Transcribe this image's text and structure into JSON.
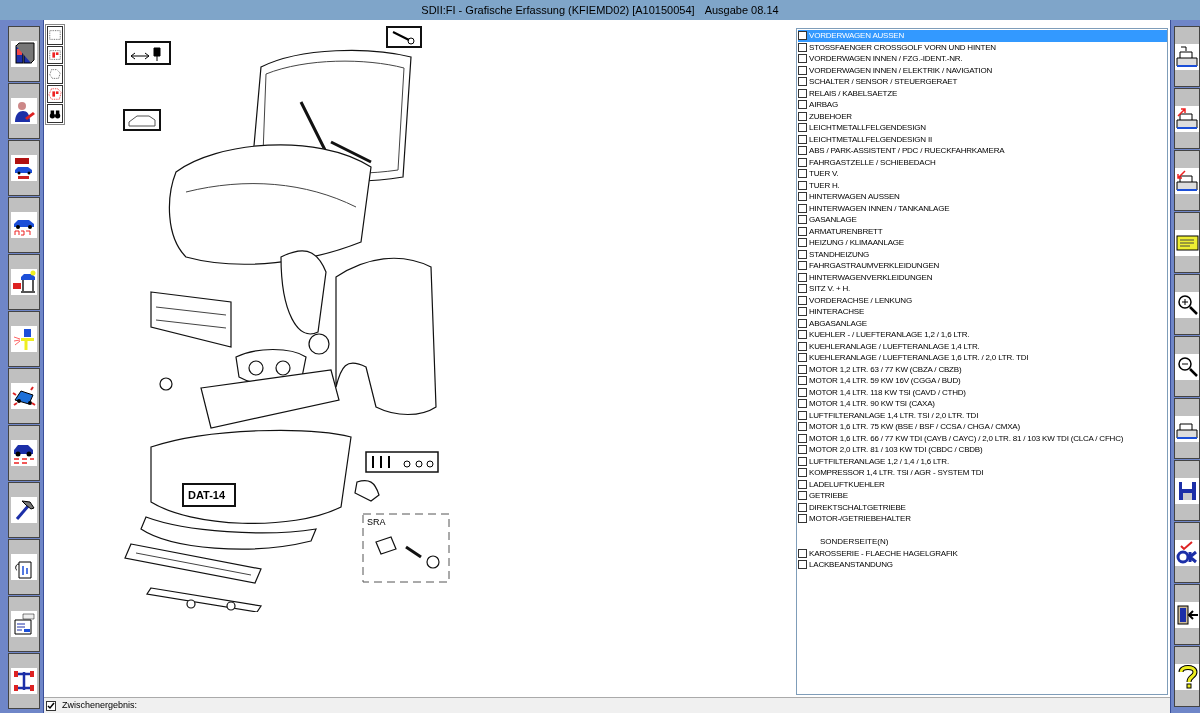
{
  "window": {
    "title": "SDII:FI - Grafische Erfassung (KFIEMD02) [A10150054]",
    "edition": "Ausgabe 08.14"
  },
  "left_toolbar": [
    {
      "kind": "binders"
    },
    {
      "kind": "mechanic"
    },
    {
      "kind": "vehicles"
    },
    {
      "kind": "inspection"
    },
    {
      "kind": "lift"
    },
    {
      "kind": "paint-gun"
    },
    {
      "kind": "damage-car"
    },
    {
      "kind": "car-checklist"
    },
    {
      "kind": "hammer"
    },
    {
      "kind": "oil-can"
    },
    {
      "kind": "claim-form"
    },
    {
      "kind": "axle"
    }
  ],
  "drawing_tools": [
    {
      "kind": "rect",
      "selected": false
    },
    {
      "kind": "rect-parts",
      "selected": false
    },
    {
      "kind": "lasso",
      "selected": false
    },
    {
      "kind": "lasso-parts",
      "selected": false
    },
    {
      "kind": "binoculars",
      "selected": false
    }
  ],
  "drawing": {
    "plate": "DAT-14",
    "inset_label": "SRA"
  },
  "parts_list": [
    {
      "kind": "item",
      "label": "VORDERWAGEN AUSSEN",
      "checked": false,
      "selected": true
    },
    {
      "kind": "item",
      "label": "STOSSFAENGER CROSSGOLF VORN UND HINTEN",
      "checked": false,
      "selected": false
    },
    {
      "kind": "item",
      "label": "VORDERWAGEN INNEN / FZG.-IDENT.-NR.",
      "checked": false,
      "selected": false
    },
    {
      "kind": "item",
      "label": "VORDERWAGEN INNEN / ELEKTRIK / NAVIGATION",
      "checked": false,
      "selected": false
    },
    {
      "kind": "item",
      "label": "SCHALTER / SENSOR / STEUERGERAET",
      "checked": false,
      "selected": false
    },
    {
      "kind": "item",
      "label": "RELAIS / KABELSAETZE",
      "checked": false,
      "selected": false
    },
    {
      "kind": "item",
      "label": "AIRBAG",
      "checked": false,
      "selected": false
    },
    {
      "kind": "item",
      "label": "ZUBEHOER",
      "checked": false,
      "selected": false
    },
    {
      "kind": "item",
      "label": "LEICHTMETALLFELGENDESIGN",
      "checked": false,
      "selected": false
    },
    {
      "kind": "item",
      "label": "LEICHTMETALLFELGENDESIGN II",
      "checked": false,
      "selected": false
    },
    {
      "kind": "item",
      "label": "ABS / PARK-ASSISTENT / PDC / RUECKFAHRKAMERA",
      "checked": false,
      "selected": false
    },
    {
      "kind": "item",
      "label": "FAHRGASTZELLE / SCHIEBEDACH",
      "checked": false,
      "selected": false
    },
    {
      "kind": "item",
      "label": "TUER V.",
      "checked": false,
      "selected": false
    },
    {
      "kind": "item",
      "label": "TUER H.",
      "checked": false,
      "selected": false
    },
    {
      "kind": "item",
      "label": "HINTERWAGEN AUSSEN",
      "checked": false,
      "selected": false
    },
    {
      "kind": "item",
      "label": "HINTERWAGEN INNEN / TANKANLAGE",
      "checked": false,
      "selected": false
    },
    {
      "kind": "item",
      "label": "GASANLAGE",
      "checked": false,
      "selected": false
    },
    {
      "kind": "item",
      "label": "ARMATURENBRETT",
      "checked": false,
      "selected": false
    },
    {
      "kind": "item",
      "label": "HEIZUNG / KLIMAANLAGE",
      "checked": false,
      "selected": false
    },
    {
      "kind": "item",
      "label": "STANDHEIZUNG",
      "checked": false,
      "selected": false
    },
    {
      "kind": "item",
      "label": "FAHRGASTRAUMVERKLEIDUNGEN",
      "checked": false,
      "selected": false
    },
    {
      "kind": "item",
      "label": "HINTERWAGENVERKLEIDUNGEN",
      "checked": false,
      "selected": false
    },
    {
      "kind": "item",
      "label": "SITZ V. + H.",
      "checked": false,
      "selected": false
    },
    {
      "kind": "item",
      "label": "VORDERACHSE / LENKUNG",
      "checked": false,
      "selected": false
    },
    {
      "kind": "item",
      "label": "HINTERACHSE",
      "checked": false,
      "selected": false
    },
    {
      "kind": "item",
      "label": "ABGASANLAGE",
      "checked": false,
      "selected": false
    },
    {
      "kind": "item",
      "label": "KUEHLER - / LUEFTERANLAGE 1,2 / 1,6 LTR.",
      "checked": false,
      "selected": false
    },
    {
      "kind": "item",
      "label": "KUEHLERANLAGE / LUEFTERANLAGE 1,4 LTR.",
      "checked": false,
      "selected": false
    },
    {
      "kind": "item",
      "label": "KUEHLERANLAGE / LUEFTERANLAGE 1,6 LTR. / 2,0 LTR. TDI",
      "checked": false,
      "selected": false
    },
    {
      "kind": "item",
      "label": "MOTOR 1,2 LTR. 63 / 77 KW (CBZA / CBZB)",
      "checked": false,
      "selected": false
    },
    {
      "kind": "item",
      "label": "MOTOR 1,4 LTR. 59 KW 16V (CGGA / BUD)",
      "checked": false,
      "selected": false
    },
    {
      "kind": "item",
      "label": "MOTOR 1,4 LTR. 118 KW TSI (CAVD / CTHD)",
      "checked": false,
      "selected": false
    },
    {
      "kind": "item",
      "label": "MOTOR 1,4 LTR. 90 KW TSI (CAXA)",
      "checked": false,
      "selected": false
    },
    {
      "kind": "item",
      "label": "LUFTFILTERANLAGE 1,4 LTR. TSI / 2,0 LTR. TDI",
      "checked": false,
      "selected": false
    },
    {
      "kind": "item",
      "label": "MOTOR 1,6 LTR. 75 KW (BSE / BSF / CCSA / CHGA / CMXA)",
      "checked": false,
      "selected": false
    },
    {
      "kind": "item",
      "label": "MOTOR 1,6 LTR. 66 / 77 KW TDI (CAYB / CAYC)  / 2,0 LTR. 81 / 103 KW TDI (CLCA / CFHC)",
      "checked": false,
      "selected": false
    },
    {
      "kind": "item",
      "label": "MOTOR 2,0 LTR. 81 / 103 KW TDI (CBDC / CBDB)",
      "checked": false,
      "selected": false
    },
    {
      "kind": "item",
      "label": "LUFTFILTERANLAGE 1,2 / 1,4 / 1,6 LTR.",
      "checked": false,
      "selected": false
    },
    {
      "kind": "item",
      "label": "KOMPRESSOR 1,4 LTR. TSI / AGR - SYSTEM TDI",
      "checked": false,
      "selected": false
    },
    {
      "kind": "item",
      "label": "LADELUFTKUEHLER",
      "checked": false,
      "selected": false
    },
    {
      "kind": "item",
      "label": "GETRIEBE",
      "checked": false,
      "selected": false
    },
    {
      "kind": "item",
      "label": "DIREKTSCHALTGETRIEBE",
      "checked": false,
      "selected": false
    },
    {
      "kind": "item",
      "label": "MOTOR-/GETRIEBEHALTER",
      "checked": false,
      "selected": false
    },
    {
      "kind": "spacer"
    },
    {
      "kind": "heading",
      "label": "SONDERSEITE(N)"
    },
    {
      "kind": "item",
      "label": "KAROSSERIE - FLAECHE HAGELGRAFIK",
      "checked": false,
      "selected": false
    },
    {
      "kind": "item",
      "label": "LACKBEANSTANDUNG",
      "checked": false,
      "selected": false
    }
  ],
  "right_toolbar": [
    {
      "kind": "doc-import"
    },
    {
      "kind": "doc-export"
    },
    {
      "kind": "doc-return"
    },
    {
      "kind": "sticky-note"
    },
    {
      "kind": "zoom-in"
    },
    {
      "kind": "zoom-out"
    },
    {
      "kind": "print"
    },
    {
      "kind": "save"
    },
    {
      "kind": "ok"
    },
    {
      "kind": "exit"
    },
    {
      "kind": "help"
    }
  ],
  "status_bar": {
    "label": "Zwischenergebnis:",
    "checked": true
  }
}
